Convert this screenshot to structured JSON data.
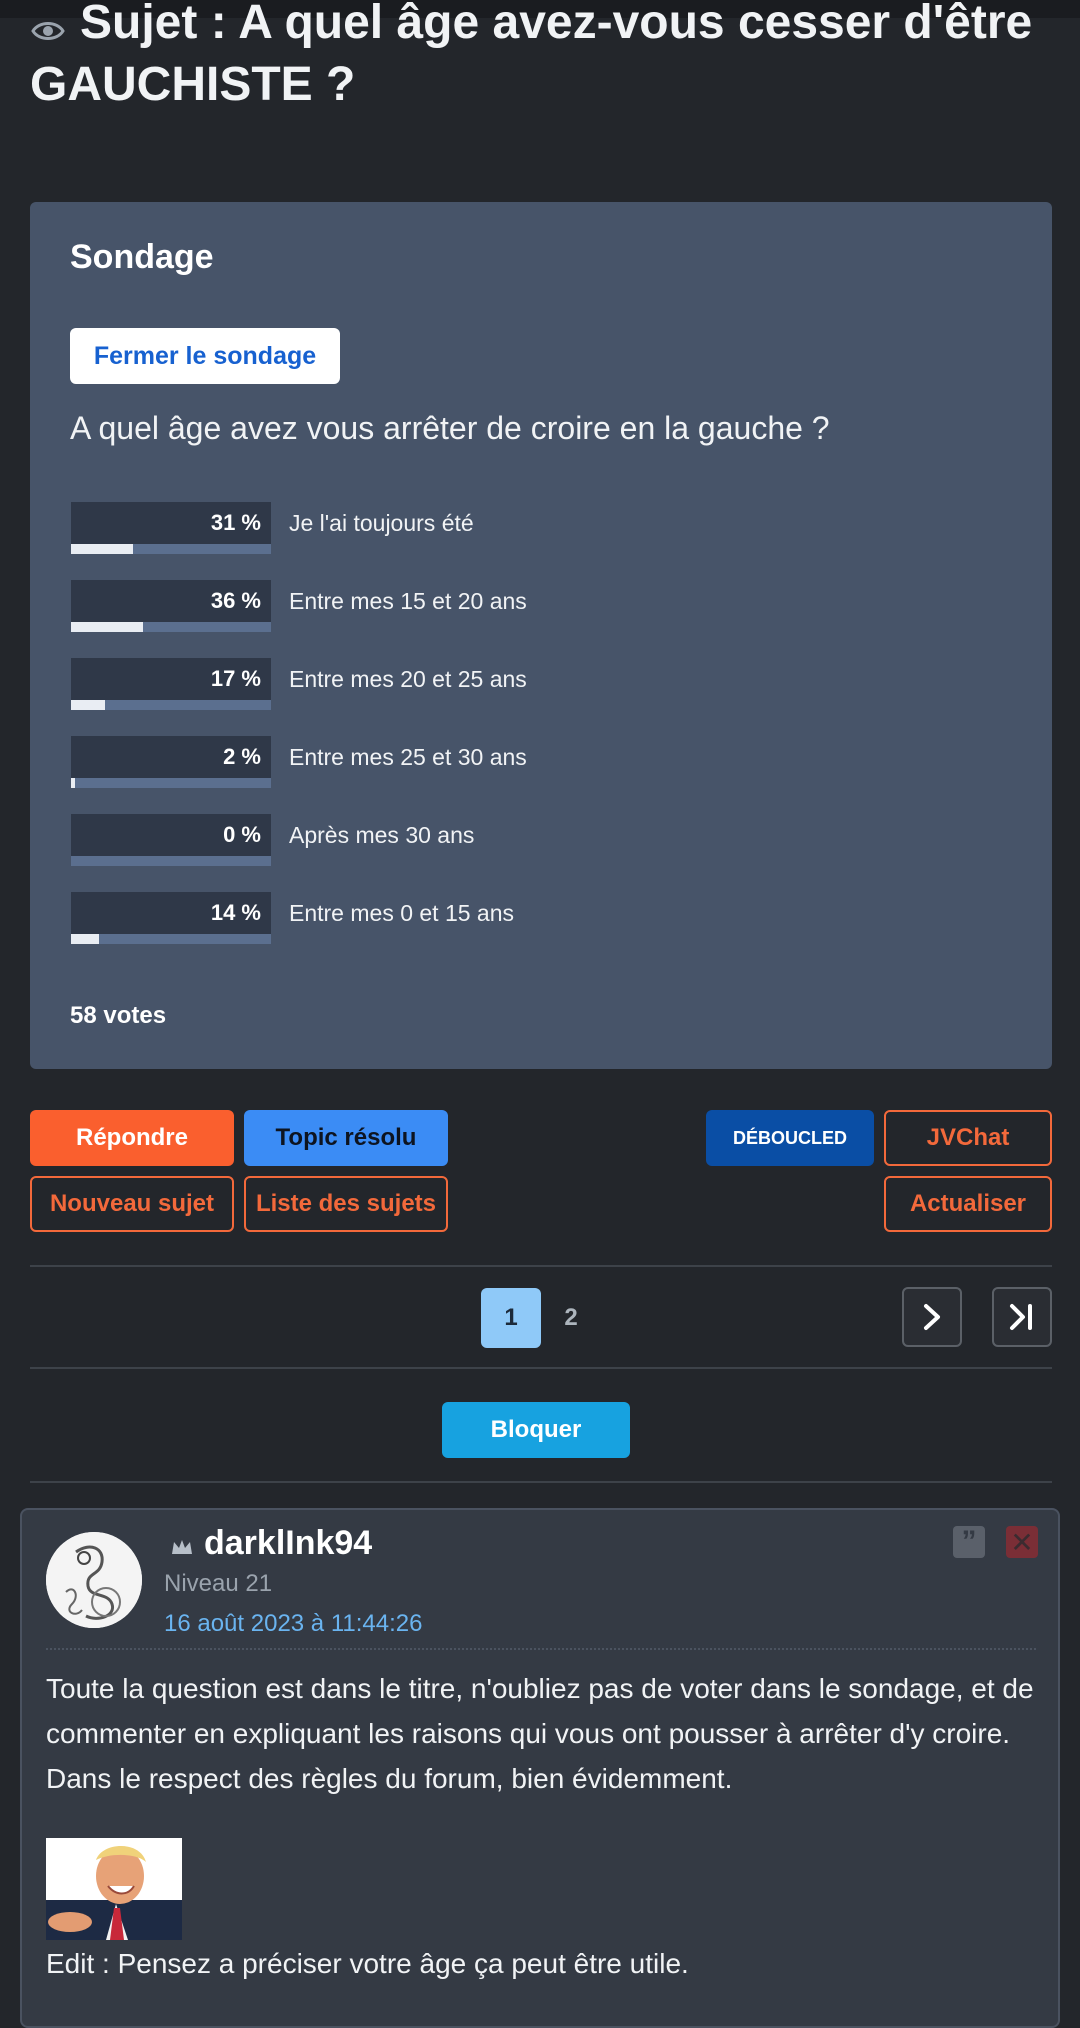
{
  "topic": {
    "title": "Sujet : A quel âge avez-vous cesser d'être GAUCHISTE ?"
  },
  "poll": {
    "heading": "Sondage",
    "close_label": "Fermer le sondage",
    "question": "A quel âge avez vous arrêter de croire en la gauche ?",
    "options": [
      {
        "pct_label": "31 %",
        "percent": 31,
        "label": "Je l'ai toujours été"
      },
      {
        "pct_label": "36 %",
        "percent": 36,
        "label": "Entre mes 15 et 20 ans"
      },
      {
        "pct_label": "17 %",
        "percent": 17,
        "label": "Entre mes 20 et 25 ans"
      },
      {
        "pct_label": "2 %",
        "percent": 2,
        "label": "Entre mes 25 et 30 ans"
      },
      {
        "pct_label": "0 %",
        "percent": 0,
        "label": "Après mes 30 ans"
      },
      {
        "pct_label": "14 %",
        "percent": 14,
        "label": "Entre mes 0 et 15 ans"
      }
    ],
    "votes": "58 votes"
  },
  "actions": {
    "reply": "Répondre",
    "resolved": "Topic résolu",
    "deboucled": "DÉBOUCLED",
    "jvchat": "JVChat",
    "new_topic": "Nouveau sujet",
    "topic_list": "Liste des sujets",
    "refresh": "Actualiser"
  },
  "pagination": {
    "current": "1",
    "next": "2",
    "next_icon": "chevron-right-icon",
    "last_icon": "last-page-icon"
  },
  "block_label": "Bloquer",
  "post": {
    "author": "darklInk94",
    "level": "Niveau 21",
    "date": "16 août 2023 à 11:44:26",
    "quote_icon": "quote-icon",
    "report_icon": "close-icon",
    "body": "Toute la question est dans le titre, n'oubliez pas de voter dans le sondage, et de commenter en expliquant les raisons qui vous ont pousser à arrêter d'y croire. Dans le respect des règles du forum, bien évidemment.",
    "edit": "Edit : Pensez a préciser votre âge ça peut être utile."
  },
  "colors": {
    "background": "#23262b",
    "poll_bg": "#475469",
    "accent_orange": "#fa5f2e",
    "accent_blue": "#3b8cf5",
    "date_link": "#6ab4f0"
  }
}
